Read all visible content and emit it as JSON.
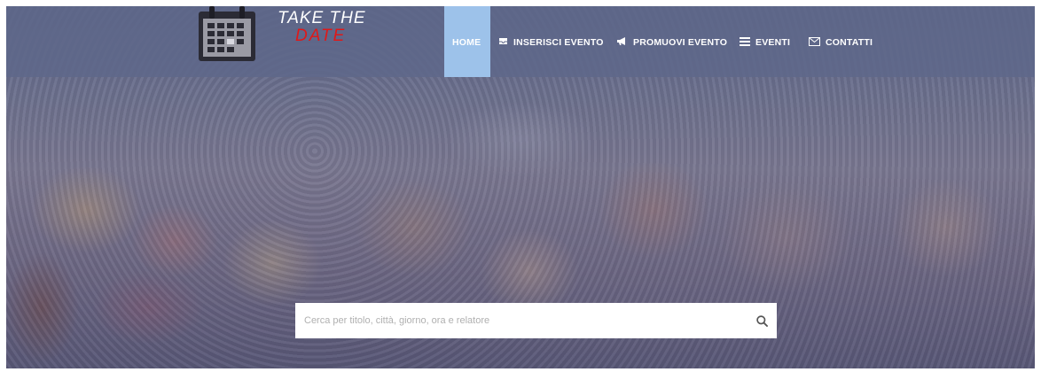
{
  "brand": {
    "line1": "TAKE THE",
    "line2": "DATE"
  },
  "nav": {
    "home": "HOME",
    "items": [
      {
        "label": "INSERISCI EVENTO",
        "icon": "inbox-icon",
        "glyph": "▰"
      },
      {
        "label": "PROMUOVI EVENTO",
        "icon": "megaphone-icon",
        "glyph": "📣"
      },
      {
        "label": "EVENTI",
        "icon": "list-icon",
        "glyph": "≡"
      },
      {
        "label": "CONTATTI",
        "icon": "envelope-icon",
        "glyph": "✉"
      }
    ]
  },
  "search": {
    "placeholder": "Cerca per titolo, città, giorno, ora e relatore",
    "value": ""
  },
  "colors": {
    "navbar": "#5f688a",
    "home_active": "#9dc2ea",
    "logo_red": "#e01818"
  }
}
